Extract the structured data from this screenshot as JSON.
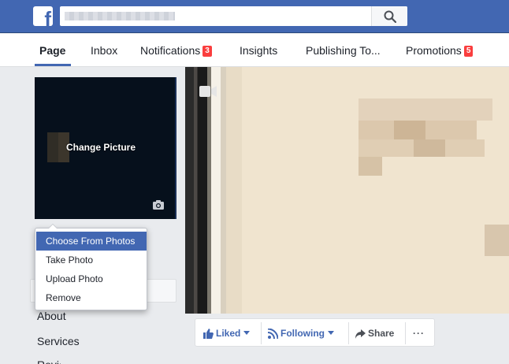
{
  "header": {
    "logo_letter": "f",
    "search_icon": "search-icon"
  },
  "tabs": [
    {
      "label": "Page",
      "badge": ""
    },
    {
      "label": "Inbox",
      "badge": ""
    },
    {
      "label": "Notifications",
      "badge": "3"
    },
    {
      "label": "Insights",
      "badge": ""
    },
    {
      "label": "Publishing To...",
      "badge": ""
    },
    {
      "label": "Promotions",
      "badge": "5"
    }
  ],
  "profile": {
    "change_picture_label": "Change Picture",
    "camera_icon": "camera-icon"
  },
  "dropdown": {
    "items": [
      {
        "label": "Choose From Photos"
      },
      {
        "label": "Take Photo"
      },
      {
        "label": "Upload Photo"
      },
      {
        "label": "Remove"
      }
    ]
  },
  "left_nav": {
    "items": [
      {
        "label": "About"
      },
      {
        "label": "Services"
      },
      {
        "label": "Reviews"
      }
    ]
  },
  "actions": {
    "liked_label": "Liked",
    "following_label": "Following",
    "share_label": "Share",
    "more_label": "···"
  },
  "colors": {
    "brand": "#4267b2",
    "badge": "#fa3e3e",
    "menu_highlight": "#4267b2"
  }
}
